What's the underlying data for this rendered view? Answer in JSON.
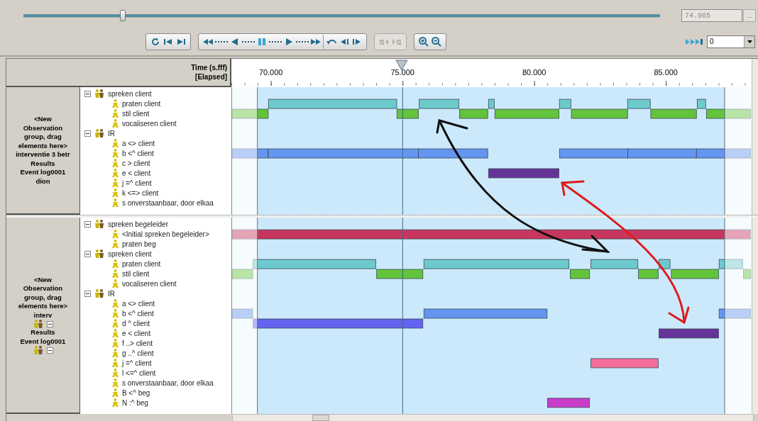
{
  "toolbar": {
    "position_slider": {
      "level": 0.156
    },
    "time_field": {
      "value": "74.965"
    },
    "browse_button": {
      "label": "..."
    },
    "button_groups": [
      [
        {
          "kind": "loop"
        },
        {
          "kind": "skip-start"
        },
        {
          "kind": "skip-end"
        }
      ],
      [
        {
          "kind": "fast-rewind"
        },
        {
          "kind": "dots"
        },
        {
          "kind": "rewind"
        },
        {
          "kind": "dots"
        },
        {
          "kind": "pause"
        },
        {
          "kind": "dots"
        },
        {
          "kind": "play"
        },
        {
          "kind": "dots"
        },
        {
          "kind": "fast-forward"
        },
        {
          "kind": "divider"
        },
        {
          "kind": "undo"
        },
        {
          "kind": "step-back"
        },
        {
          "kind": "step-forward"
        }
      ]
    ],
    "sync_button": {
      "disabled": true
    },
    "zoom_buttons": [
      {
        "kind": "zoom-in"
      },
      {
        "kind": "zoom-out"
      }
    ],
    "speed_select": {
      "value": "0"
    }
  },
  "header": {
    "time_label": "Time (s.fff)",
    "time_sublabel": "[Elapsed]"
  },
  "ruler": {
    "ticks": [
      "70.000",
      "75.000",
      "80.000",
      "85.000"
    ]
  },
  "groups": [
    {
      "label_lines": [
        {
          "kind": "text",
          "text": "<New"
        },
        {
          "kind": "text",
          "text": "Observation"
        },
        {
          "kind": "text",
          "text": "group, drag"
        },
        {
          "kind": "text",
          "text": "elements here>"
        },
        {
          "kind": "text",
          "text": "interventie 3 betr"
        },
        {
          "kind": "text",
          "text": "Results"
        },
        {
          "kind": "text",
          "text": "Event log0001"
        },
        {
          "kind": "text",
          "text": "dion"
        }
      ],
      "tree": [
        {
          "label": "spreken client",
          "expanded": true,
          "children": [
            {
              "label": "praten client"
            },
            {
              "label": "stil client"
            },
            {
              "label": "vocaliseren client"
            }
          ]
        },
        {
          "label": "IR",
          "expanded": true,
          "children": [
            {
              "label": "a <> client"
            },
            {
              "label": "b <^ client"
            },
            {
              "label": "c > client"
            },
            {
              "label": "e < client"
            },
            {
              "label": "j =^ client"
            },
            {
              "label": "k <=> client"
            },
            {
              "label": "s onverstaanbaar, door elkaa"
            }
          ]
        }
      ]
    },
    {
      "label_lines": [
        {
          "kind": "text",
          "text": "<New"
        },
        {
          "kind": "text",
          "text": "Observation"
        },
        {
          "kind": "text",
          "text": "group, drag"
        },
        {
          "kind": "text",
          "text": "elements here>"
        },
        {
          "kind": "text",
          "text": "interv"
        },
        {
          "kind": "icons"
        },
        {
          "kind": "text",
          "text": "Results"
        },
        {
          "kind": "text",
          "text": "Event log0001"
        },
        {
          "kind": "icons"
        }
      ],
      "tree": [
        {
          "label": "spreken begeleider",
          "expanded": true,
          "children": [
            {
              "label": "<Initial spreken begeleider>"
            },
            {
              "label": "praten beg"
            }
          ]
        },
        {
          "label": "spreken client",
          "expanded": true,
          "children": [
            {
              "label": "praten client"
            },
            {
              "label": "stil client"
            },
            {
              "label": "vocaliseren client"
            }
          ]
        },
        {
          "label": "IR",
          "expanded": true,
          "children": [
            {
              "label": "a <> client"
            },
            {
              "label": "b <^ client"
            },
            {
              "label": "d ^ client"
            },
            {
              "label": "e < client"
            },
            {
              "label": "f ..> client"
            },
            {
              "label": "g ..^ client"
            },
            {
              "label": "j =^ client"
            },
            {
              "label": "l <=^ client"
            },
            {
              "label": "s onverstaanbaar, door elkaa"
            },
            {
              "label": "B <^ beg"
            },
            {
              "label": "N :^ beg"
            }
          ]
        }
      ]
    }
  ]
}
